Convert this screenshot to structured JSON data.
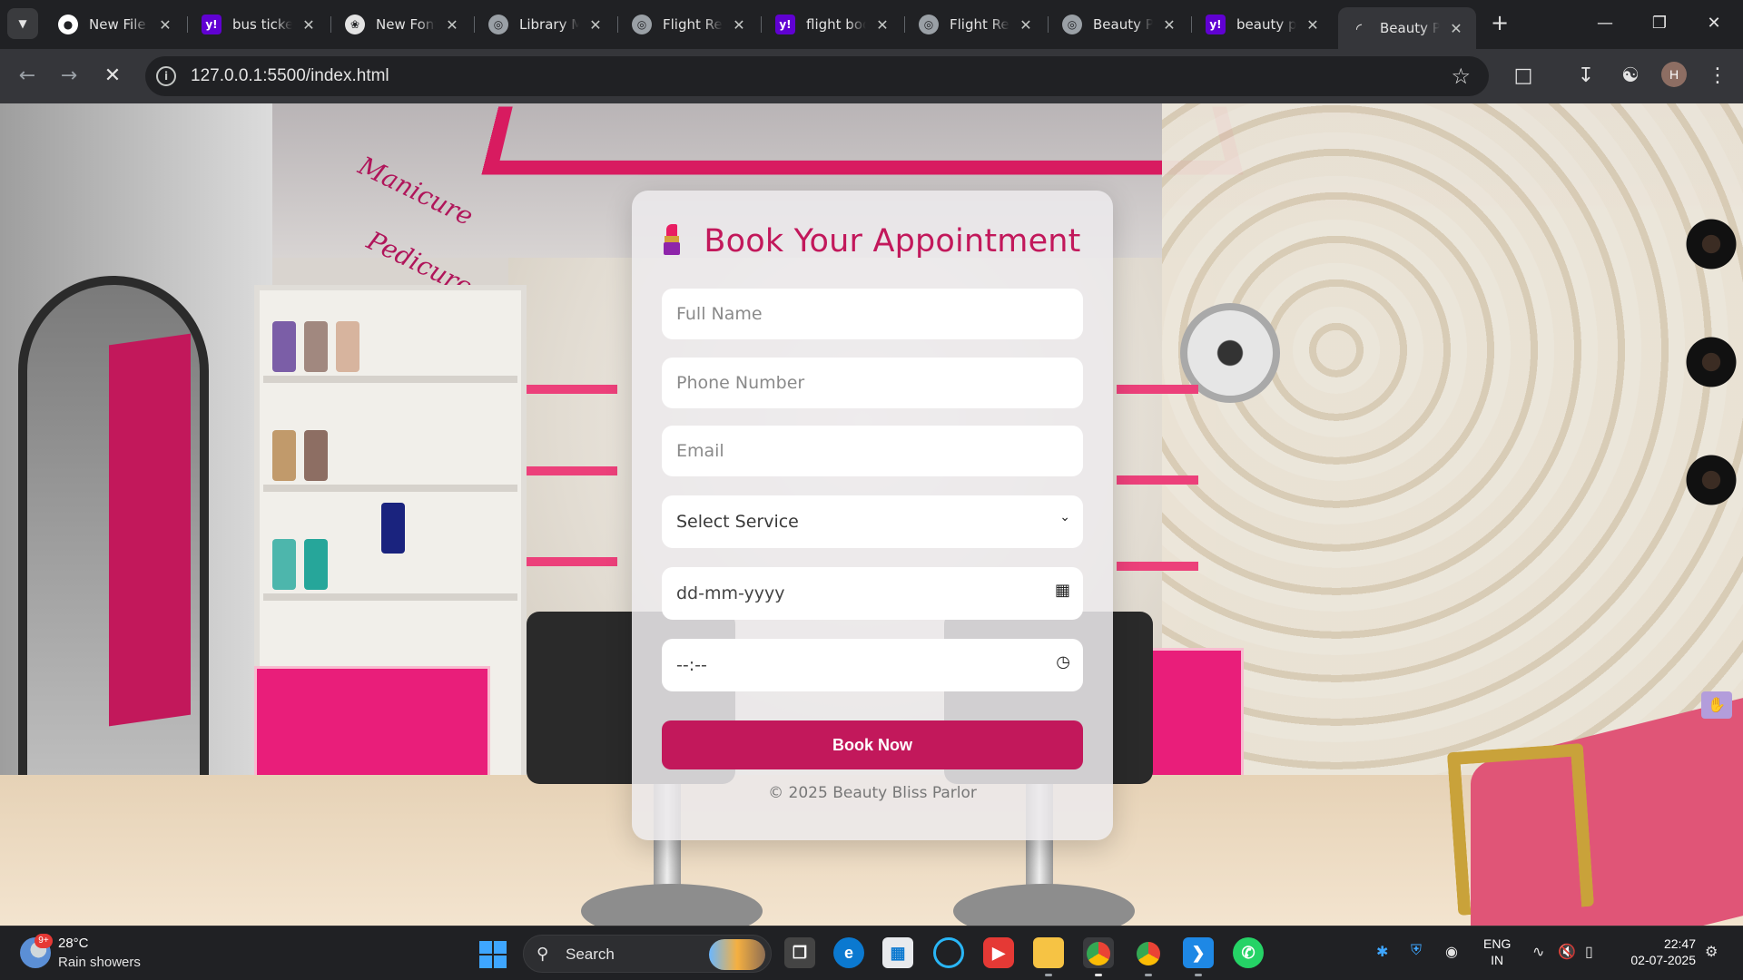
{
  "browser": {
    "tabs": [
      {
        "title": "New File a",
        "favicon": "github-icon"
      },
      {
        "title": "bus ticket",
        "favicon": "yahoo-icon"
      },
      {
        "title": "New Font",
        "favicon": "chatgpt-icon"
      },
      {
        "title": "Library M",
        "favicon": "globe-icon"
      },
      {
        "title": "Flight Res",
        "favicon": "globe-icon"
      },
      {
        "title": "flight boo",
        "favicon": "yahoo-icon"
      },
      {
        "title": "Flight Res",
        "favicon": "globe-icon"
      },
      {
        "title": "Beauty Pa",
        "favicon": "globe-icon"
      },
      {
        "title": "beauty pa",
        "favicon": "yahoo-icon"
      },
      {
        "title": "Beauty Pa",
        "favicon": "loading-icon",
        "active": true
      }
    ],
    "url": "127.0.0.1:5500/index.html",
    "profile_initial": "H"
  },
  "page": {
    "title": "Book Your Appointment",
    "form": {
      "full_name_placeholder": "Full Name",
      "phone_placeholder": "Phone Number",
      "email_placeholder": "Email",
      "service_selected": "Select Service",
      "date_placeholder": "dd-mm-yyyy",
      "time_placeholder": "--:--",
      "submit_label": "Book Now"
    },
    "footer": "© 2025 Beauty Bliss Parlor",
    "background_signage": [
      "Manicure",
      "Pedicure"
    ],
    "colors": {
      "accent": "#c2185b",
      "card_bg": "#ecebec"
    }
  },
  "taskbar": {
    "weather_badge": "9+",
    "weather_temp": "28°C",
    "weather_desc": "Rain showers",
    "search_label": "Search",
    "lang_primary": "ENG",
    "lang_secondary": "IN",
    "time": "22:47",
    "date": "02-07-2025"
  }
}
